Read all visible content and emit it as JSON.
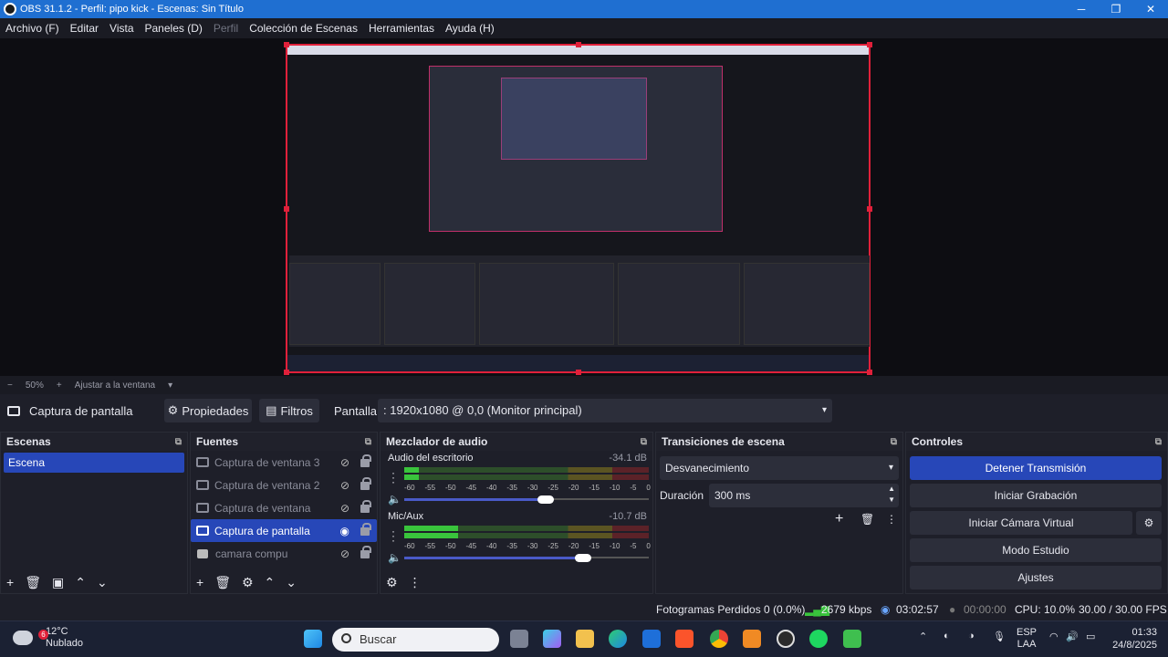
{
  "window": {
    "title": "OBS 31.1.2 - Perfil: pipo kick - Escenas: Sin Título",
    "min": "─",
    "max": "❐",
    "close": "✕"
  },
  "menu": [
    "Archivo (F)",
    "Editar",
    "Vista",
    "Paneles (D)",
    "Perfil",
    "Colección de Escenas",
    "Herramientas",
    "Ayuda (H)"
  ],
  "zoom": {
    "minus": "−",
    "value": "50%",
    "plus": "+",
    "fit": "Ajustar a la ventana",
    "arrow": "▾"
  },
  "source_bar": {
    "name": "Captura de pantalla",
    "properties": "Propiedades",
    "filters": "Filtros",
    "display_label": "Pantalla",
    "display_value": ": 1920x1080 @ 0,0 (Monitor principal)",
    "arrow": "▾"
  },
  "scenes": {
    "title": "Escenas",
    "items": [
      "Escena"
    ]
  },
  "sources": {
    "title": "Fuentes",
    "items": [
      "Captura de ventana 3",
      "Captura de ventana 2",
      "Captura de ventana",
      "Captura de pantalla",
      "camara compu"
    ]
  },
  "mixer": {
    "title": "Mezclador de audio",
    "ticks": [
      "-60",
      "-55",
      "-50",
      "-45",
      "-40",
      "-35",
      "-30",
      "-25",
      "-20",
      "-15",
      "-10",
      "-5",
      "0"
    ],
    "channels": [
      {
        "name": "Audio del escritorio",
        "db": "-34.1 dB",
        "level": 0.06,
        "volume": 0.58
      },
      {
        "name": "Mic/Aux",
        "db": "-10.7 dB",
        "level": 0.22,
        "volume": 0.73
      }
    ]
  },
  "transitions": {
    "title": "Transiciones de escena",
    "type": "Desvanecimiento",
    "duration_label": "Duración",
    "duration_value": "300 ms"
  },
  "controls": {
    "title": "Controles",
    "stream": "Detener Transmisión",
    "record": "Iniciar Grabación",
    "vcam": "Iniciar Cámara Virtual",
    "studio": "Modo Estudio",
    "settings": "Ajustes"
  },
  "status": {
    "dropped": "Fotogramas Perdidos 0 (0.0%)",
    "kbps": "2679 kbps",
    "stream_time": "03:02:57",
    "rec_time": "00:00:00",
    "cpu": "CPU: 10.0%",
    "fps": "30.00 / 30.00 FPS"
  },
  "taskbar": {
    "weather_temp": "12°C",
    "weather_desc": "Nublado",
    "weather_badge": "6",
    "search": "Buscar",
    "lang1": "ESP",
    "lang2": "LAA",
    "time": "01:33",
    "date": "24/8/2025"
  },
  "colors": {
    "accent": "#2747b8",
    "title_bar": "#1f6fd1",
    "selection_border": "#e0203a"
  }
}
